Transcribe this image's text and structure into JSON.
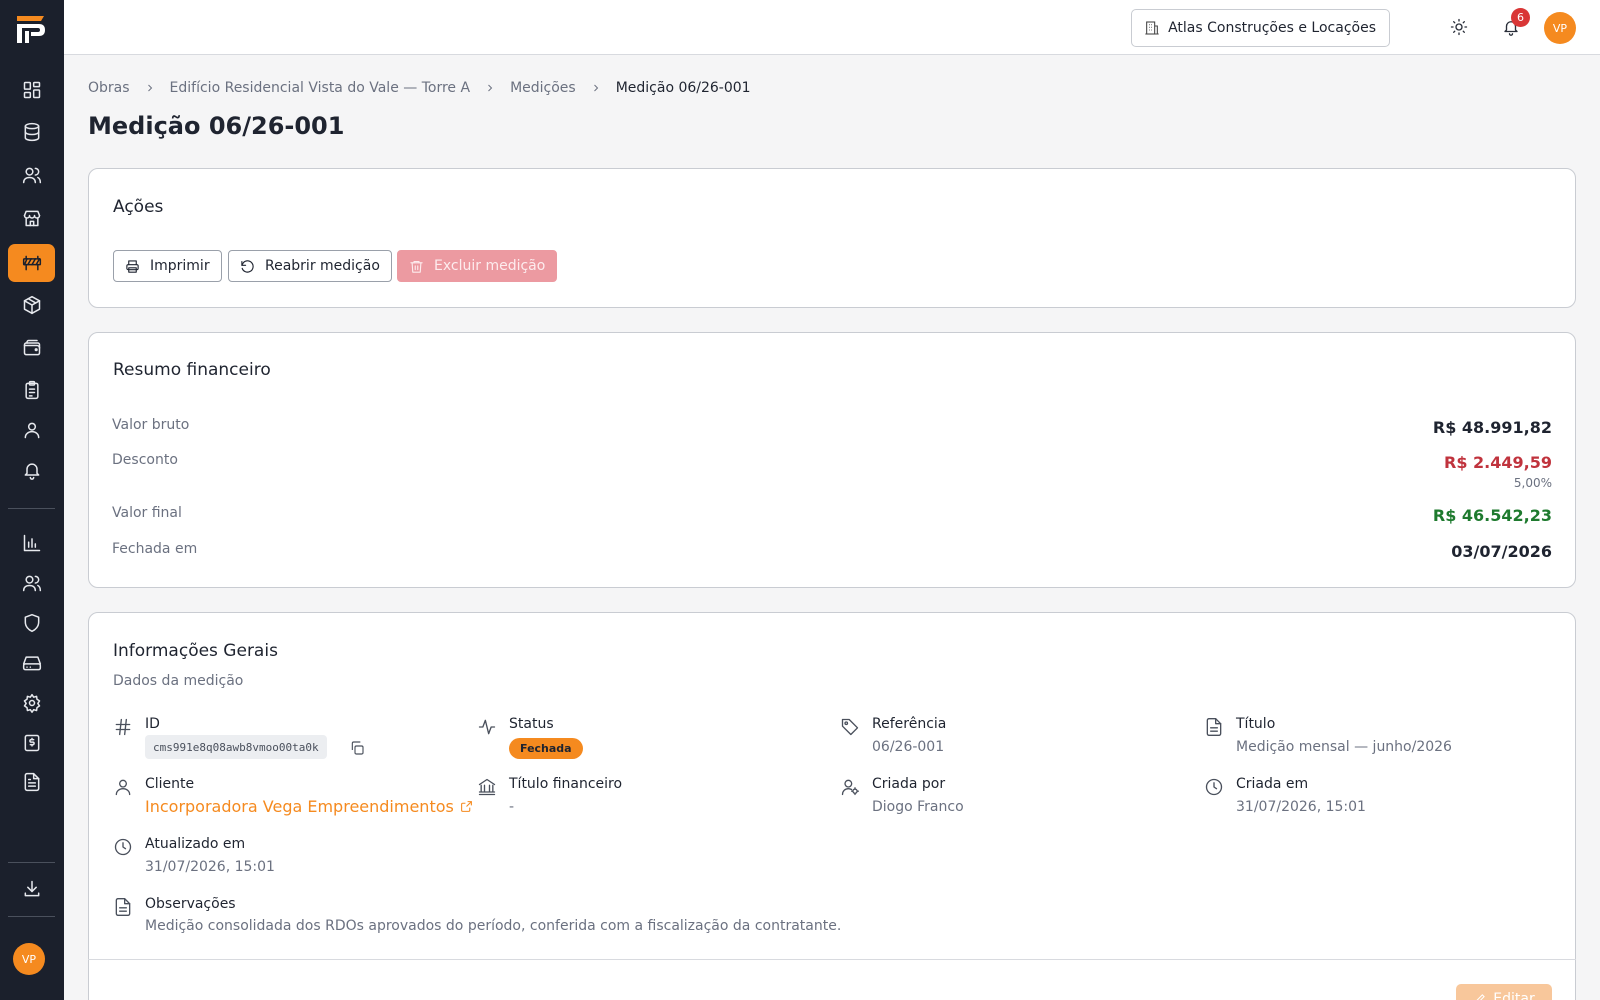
{
  "header": {
    "company": "Atlas Construções e Locações",
    "notification_count": "6",
    "avatar_initials": "VP"
  },
  "sidebar": {
    "items": [
      {
        "icon": "dashboard-icon"
      },
      {
        "icon": "database-icon"
      },
      {
        "icon": "users-icon"
      },
      {
        "icon": "store-icon"
      },
      {
        "icon": "construction-barrier-icon",
        "active": true
      },
      {
        "icon": "package-icon"
      },
      {
        "icon": "wallet-icon"
      },
      {
        "icon": "clipboard-icon"
      },
      {
        "icon": "user-icon"
      },
      {
        "icon": "bell-icon"
      },
      {
        "icon": "bar-chart-icon"
      },
      {
        "icon": "team-icon"
      },
      {
        "icon": "shield-icon"
      },
      {
        "icon": "hard-drive-icon"
      },
      {
        "icon": "settings-icon"
      },
      {
        "icon": "receipt-icon"
      },
      {
        "icon": "file-text-icon"
      },
      {
        "icon": "download-icon"
      }
    ],
    "avatar_initials": "VP",
    "accent_color": "#f58a1f"
  },
  "breadcrumb": [
    "Obras",
    "Edifício Residencial Vista do Vale — Torre A",
    "Medições",
    "Medição 06/26-001"
  ],
  "page_title": "Medição 06/26-001",
  "actions": {
    "title": "Ações",
    "print": "Imprimir",
    "reopen": "Reabrir medição",
    "delete": "Excluir medição"
  },
  "financial": {
    "title": "Resumo financeiro",
    "gross_label": "Valor bruto",
    "gross_value": "R$ 48.991,82",
    "discount_label": "Desconto",
    "discount_value": "R$ 2.449,59",
    "discount_percent": "5,00%",
    "final_label": "Valor final",
    "final_value": "R$ 46.542,23",
    "closed_label": "Fechada em",
    "closed_value": "03/07/2026"
  },
  "info": {
    "title": "Informações Gerais",
    "subtitle": "Dados da medição",
    "id_label": "ID",
    "id_value": "cms991e8q08awb8vmoo00ta0k",
    "status_label": "Status",
    "status_value": "Fechada",
    "reference_label": "Referência",
    "reference_value": "06/26-001",
    "title_label": "Título",
    "title_value": "Medição mensal — junho/2026",
    "client_label": "Cliente",
    "client_value": "Incorporadora Vega Empreendimentos",
    "fin_title_label": "Título financeiro",
    "fin_title_value": "-",
    "created_by_label": "Criada por",
    "created_by_value": "Diogo Franco",
    "created_at_label": "Criada em",
    "created_at_value": "31/07/2026, 15:01",
    "updated_at_label": "Atualizado em",
    "updated_at_value": "31/07/2026, 15:01",
    "notes_label": "Observações",
    "notes_value": "Medição consolidada dos RDOs aprovados do período, conferida com a fiscalização da contratante."
  },
  "footer": {
    "edit": "Editar"
  }
}
